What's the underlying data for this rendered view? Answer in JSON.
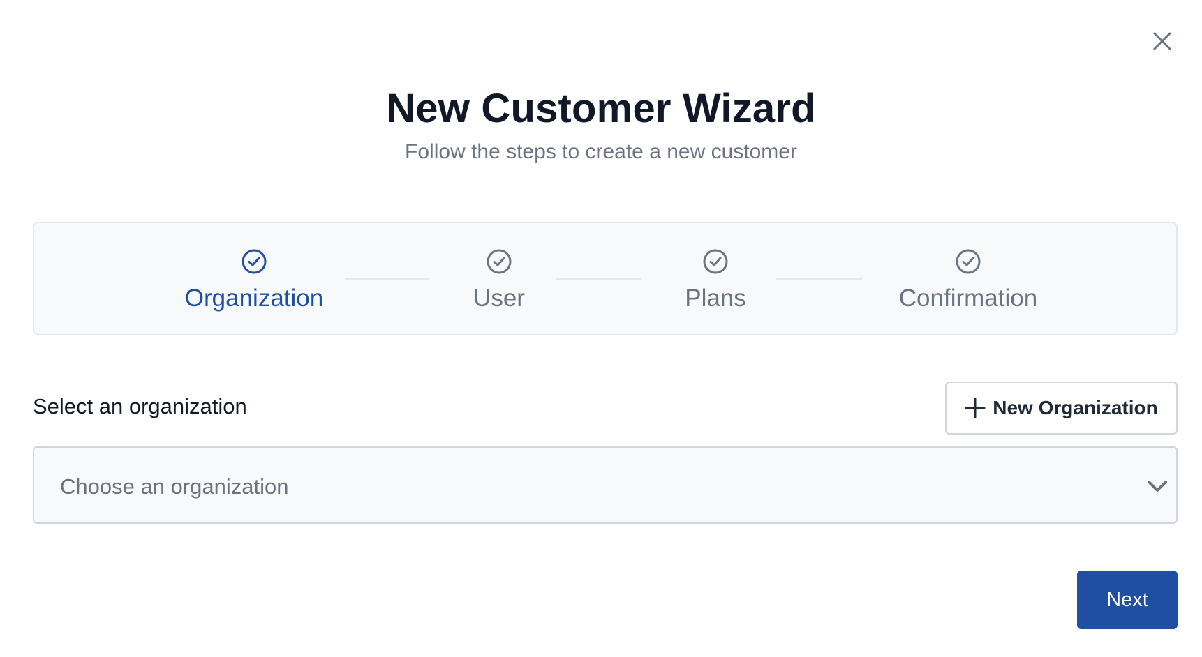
{
  "dialog": {
    "title": "New Customer Wizard",
    "subtitle": "Follow the steps to create a new customer",
    "close_icon": "close-icon"
  },
  "steps": [
    {
      "label": "Organization",
      "icon": "check-circle-icon",
      "active": true
    },
    {
      "label": "User",
      "icon": "check-circle-icon",
      "active": false
    },
    {
      "label": "Plans",
      "icon": "check-circle-icon",
      "active": false
    },
    {
      "label": "Confirmation",
      "icon": "check-circle-icon",
      "active": false
    }
  ],
  "organization": {
    "section_label": "Select an organization",
    "new_button_label": "New Organization",
    "new_button_icon": "plus-icon",
    "select_placeholder": "Choose an organization",
    "select_icon": "chevron-down-icon"
  },
  "footer": {
    "next_label": "Next"
  },
  "colors": {
    "accent": "#1e4fa3",
    "muted_text": "#6b7280",
    "border": "#d1d5db",
    "panel_bg": "#f8f9fb"
  }
}
